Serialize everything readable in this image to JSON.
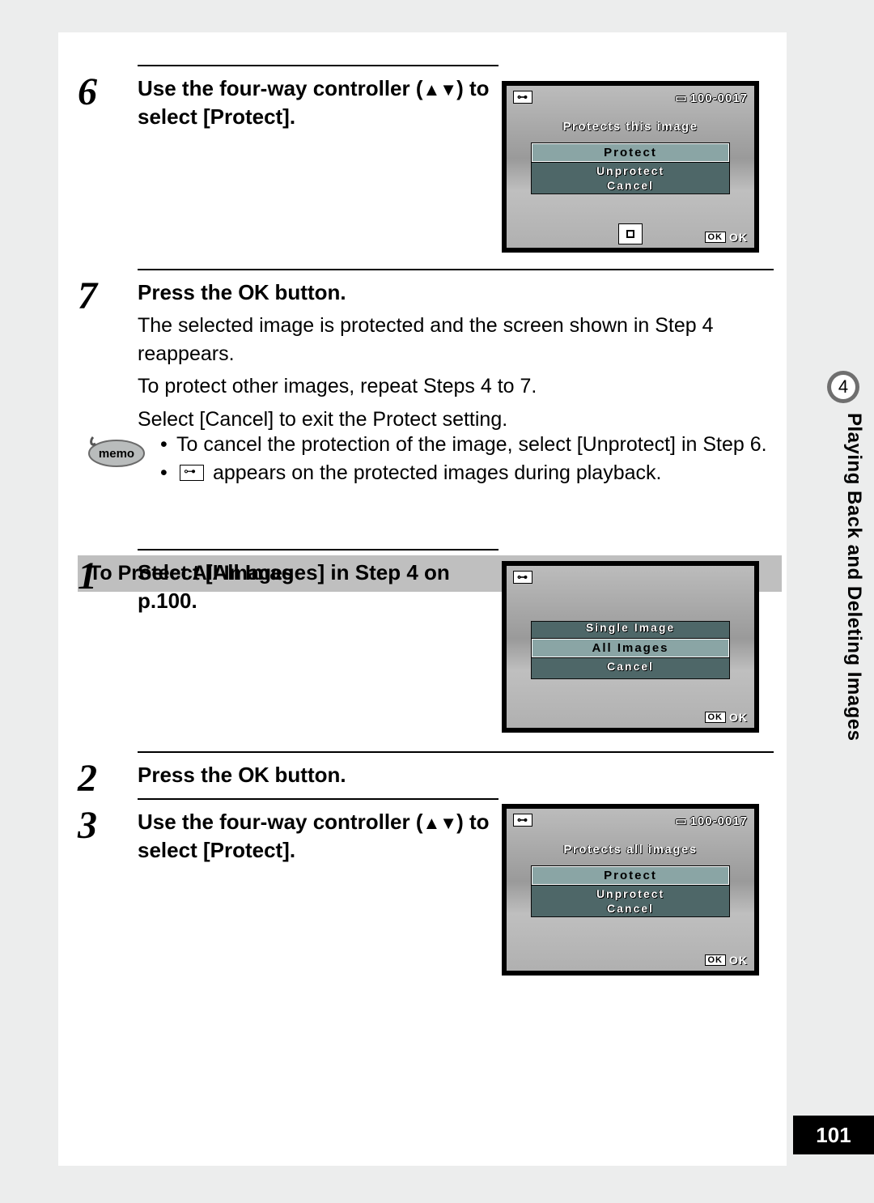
{
  "chapter_number": "4",
  "chapter_title": "Playing Back and Deleting Images",
  "page_number": "101",
  "steps_first": {
    "s6": {
      "num": "6",
      "title_prefix": "Use the four-way controller (",
      "title_arrows": "▲▼",
      "title_suffix": ") to select [Protect]."
    },
    "s7": {
      "num": "7",
      "title_prefix": "Press the ",
      "title_ok": "OK",
      "title_suffix": " button.",
      "body1": "The selected image is protected and the screen shown in Step 4 reappears.",
      "body2": "To protect other images, repeat Steps 4 to 7.",
      "body3": "Select [Cancel] to exit the Protect setting."
    }
  },
  "memo": {
    "m1": "To cancel the protection of the image, select [Unprotect] in Step 6.",
    "m2_suffix": " appears on the protected images during playback."
  },
  "section_heading": "To Protect All Images",
  "steps_second": {
    "s1": {
      "num": "1",
      "title": "Select [All Images] in Step 4 on p.100."
    },
    "s2": {
      "num": "2",
      "title_prefix": "Press the ",
      "title_ok": "OK",
      "title_suffix": " button."
    },
    "s3": {
      "num": "3",
      "title_prefix": "Use the four-way controller (",
      "title_arrows": "▲▼",
      "title_suffix": ") to select [Protect]."
    }
  },
  "lcd1": {
    "file_id": "100-0017",
    "caption": "Protects this image",
    "menu": {
      "highlight": "Protect",
      "item2": "Unprotect",
      "item3": "Cancel"
    },
    "ok_box": "OK",
    "ok_label": "OK",
    "key_icon": "⊶"
  },
  "lcd2": {
    "menu": {
      "item1": "Single Image",
      "highlight": "All Images",
      "item3": "Cancel"
    },
    "ok_box": "OK",
    "ok_label": "OK",
    "key_icon": "⊶"
  },
  "lcd3": {
    "file_id": "100-0017",
    "caption": "Protects all images",
    "menu": {
      "highlight": "Protect",
      "item2": "Unprotect",
      "item3": "Cancel"
    },
    "ok_box": "OK",
    "ok_label": "OK",
    "key_icon": "⊶"
  }
}
